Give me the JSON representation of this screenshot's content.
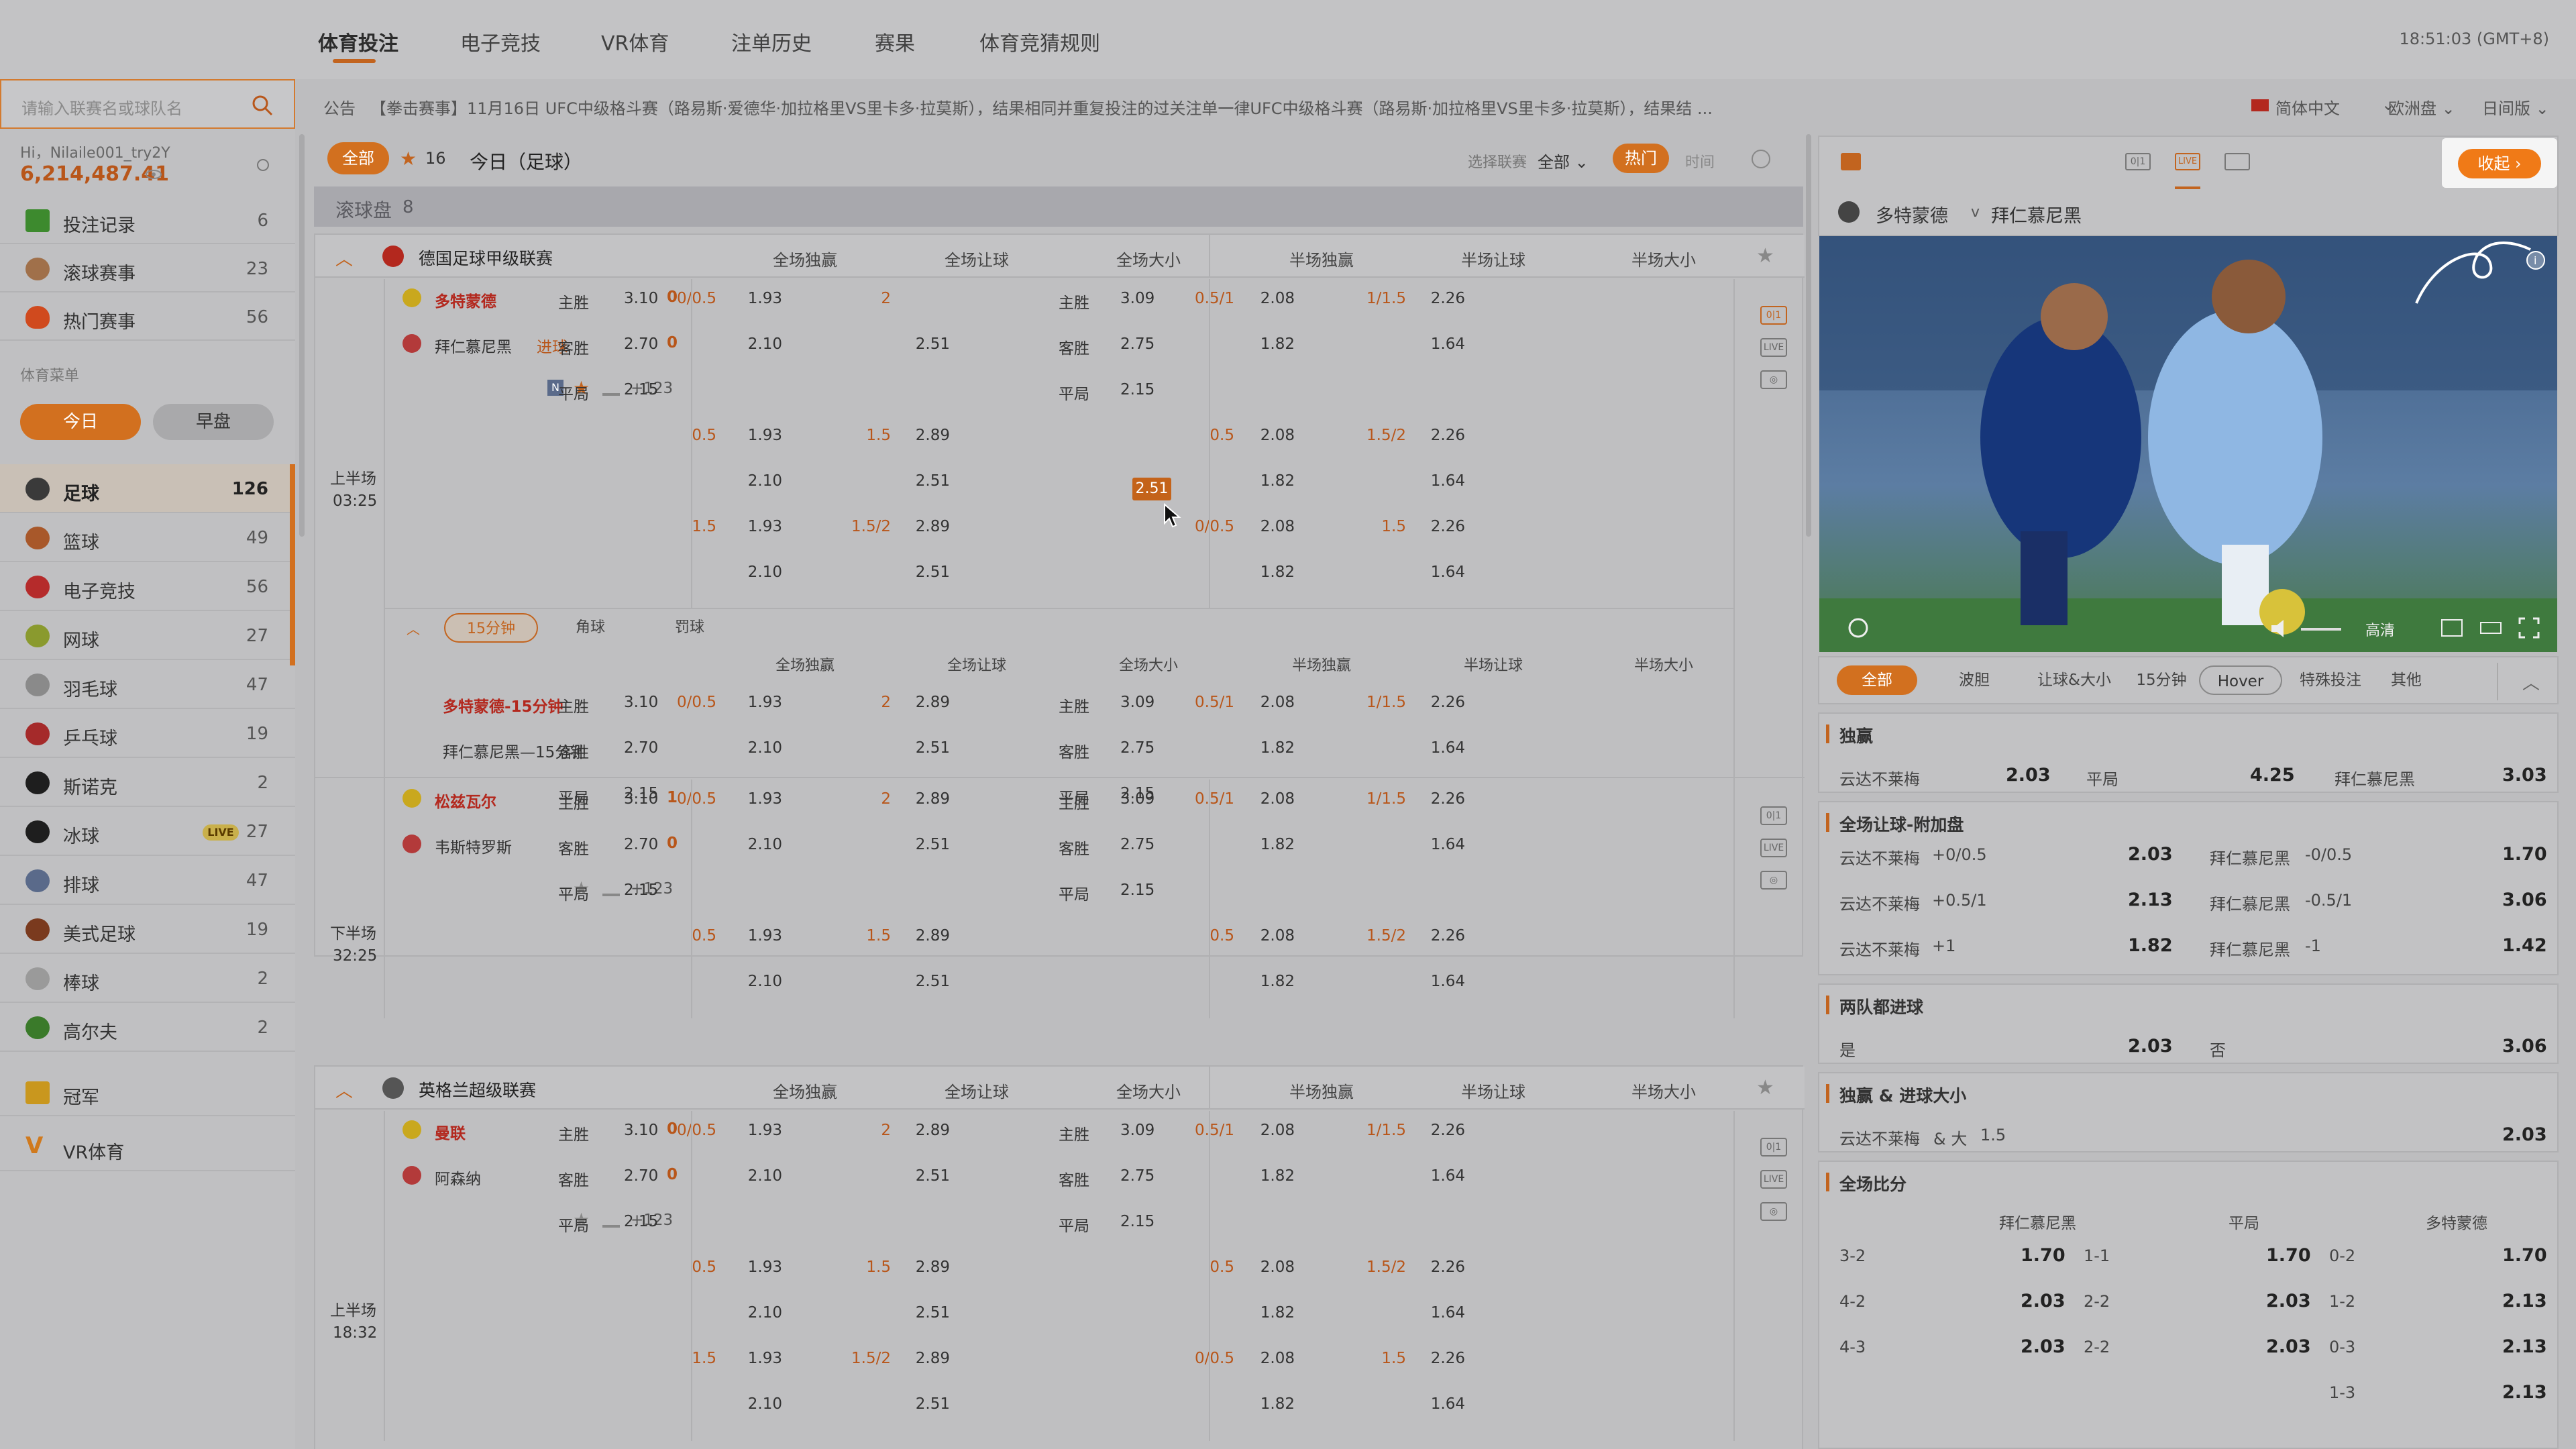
{
  "nav": {
    "items": [
      "体育投注",
      "电子竞技",
      "VR体育",
      "注单历史",
      "赛果",
      "体育竞猜规则"
    ],
    "clock": "18:51:03 (GMT+8)"
  },
  "search": {
    "placeholder": "请输入联赛名或球队名"
  },
  "notice": {
    "label": "公告",
    "text": "【拳击赛事】11月16日 UFC中级格斗赛（路易斯·爱德华·加拉格里VS里卡多·拉莫斯），结果相同并重复投注的过关注单一律UFC中级格斗赛（路易斯·加拉格里VS里卡多·拉莫斯），结果结 ...",
    "language": "简体中文",
    "odds_type": "欧洲盘",
    "view": "日间版"
  },
  "user": {
    "hi": "Hi，Nilaile001_try2Y",
    "balance": "6,214,487.41"
  },
  "sidebar": {
    "top_items": [
      {
        "label": "投注记录",
        "count": "6"
      },
      {
        "label": "滚球赛事",
        "count": "23"
      },
      {
        "label": "热门赛事",
        "count": "56"
      }
    ],
    "menu_title": "体育菜单",
    "today": "今日",
    "early": "早盘",
    "sports": [
      {
        "label": "足球",
        "count": "126",
        "color": "#3a3a3a"
      },
      {
        "label": "篮球",
        "count": "49",
        "color": "#a8582a"
      },
      {
        "label": "电子竞技",
        "count": "56",
        "color": "#b52b2b"
      },
      {
        "label": "网球",
        "count": "27",
        "color": "#8a9a2e"
      },
      {
        "label": "羽毛球",
        "count": "47",
        "color": "#8a8a8a"
      },
      {
        "label": "乒乓球",
        "count": "19",
        "color": "#a52a2a"
      },
      {
        "label": "斯诺克",
        "count": "2",
        "color": "#1e1e1e"
      },
      {
        "label": "冰球",
        "count": "27",
        "color": "#1e1e1e"
      },
      {
        "label": "排球",
        "count": "47",
        "color": "#5a6a8a"
      },
      {
        "label": "美式足球",
        "count": "19",
        "color": "#7a3a1e"
      },
      {
        "label": "棒球",
        "count": "2",
        "color": "#9a9a9a"
      },
      {
        "label": "高尔夫",
        "count": "2",
        "color": "#3a7a2a"
      }
    ],
    "live_badge": "LIVE",
    "champion": "冠军",
    "vr": "VR体育"
  },
  "main": {
    "filter_all": "全部",
    "fav_count": "16",
    "today_label": "今日（足球）",
    "select_league": "选择联赛",
    "select_value": "全部",
    "hot": "热门",
    "time": "时间",
    "inplay_label": "滚球盘",
    "inplay_count": "8",
    "col_headers": [
      "全场独赢",
      "全场让球",
      "全场大小",
      "半场独赢",
      "半场让球",
      "半场大小"
    ],
    "leagues": [
      "德国足球甲级联赛",
      "英格兰超级联赛"
    ],
    "more_markets": "+123",
    "sub_tabs": [
      "15分钟",
      "角球",
      "罚球"
    ]
  },
  "match1": {
    "home": "多特蒙德",
    "away": "拜仁慕尼黑",
    "goal_note": "进球",
    "home_score": "0",
    "away_score": "0",
    "period": "上半场",
    "time": "03:25",
    "rows": [
      [
        "主胜",
        "3.10",
        "0/0.5",
        "1.93",
        "2",
        "",
        "主胜",
        "3.09",
        "0.5/1",
        "2.08",
        "1/1.5",
        "2.26"
      ],
      [
        "客胜",
        "2.70",
        "",
        "2.10",
        "",
        "2.51",
        "客胜",
        "2.75",
        "",
        "1.82",
        "",
        "1.64"
      ],
      [
        "平局",
        "2.15",
        "",
        "",
        "",
        "",
        "平局",
        "2.15",
        "",
        "",
        "",
        ""
      ],
      [
        "",
        "",
        "0.5",
        "1.93",
        "1.5",
        "2.89",
        "",
        "",
        "0.5",
        "2.08",
        "1.5/2",
        "2.26"
      ],
      [
        "",
        "",
        "",
        "2.10",
        "",
        "2.51",
        "",
        "",
        "",
        "1.82",
        "",
        "1.64"
      ],
      [
        "",
        "",
        "1.5",
        "1.93",
        "1.5/2",
        "2.89",
        "",
        "",
        "0/0.5",
        "2.08",
        "1.5",
        "2.26"
      ],
      [
        "",
        "",
        "",
        "2.10",
        "",
        "2.51",
        "",
        "",
        "",
        "1.82",
        "",
        "1.64"
      ]
    ],
    "sub_home": "多特蒙德-15分钟",
    "sub_away": "拜仁慕尼黑—15分钟",
    "sub_rows": [
      [
        "主胜",
        "3.10",
        "0/0.5",
        "1.93",
        "2",
        "2.89",
        "主胜",
        "3.09",
        "0.5/1",
        "2.08",
        "1/1.5",
        "2.26"
      ],
      [
        "客胜",
        "2.70",
        "",
        "2.10",
        "",
        "2.51",
        "客胜",
        "2.75",
        "",
        "1.82",
        "",
        "1.64"
      ],
      [
        "平局",
        "2.15",
        "",
        "",
        "",
        "",
        "平局",
        "2.15",
        "",
        "",
        "",
        ""
      ]
    ]
  },
  "match2": {
    "home": "松兹瓦尔",
    "away": "韦斯特罗斯",
    "home_score": "1",
    "away_score": "0",
    "period": "下半场",
    "time": "32:25",
    "rows": [
      [
        "主胜",
        "3.10",
        "0/0.5",
        "1.93",
        "2",
        "2.89",
        "主胜",
        "3.09",
        "0.5/1",
        "2.08",
        "1/1.5",
        "2.26"
      ],
      [
        "客胜",
        "2.70",
        "",
        "2.10",
        "",
        "2.51",
        "客胜",
        "2.75",
        "",
        "1.82",
        "",
        "1.64"
      ],
      [
        "平局",
        "2.15",
        "",
        "",
        "",
        "",
        "平局",
        "2.15",
        "",
        "",
        "",
        ""
      ],
      [
        "",
        "",
        "0.5",
        "1.93",
        "1.5",
        "2.89",
        "",
        "",
        "0.5",
        "2.08",
        "1.5/2",
        "2.26"
      ],
      [
        "",
        "",
        "",
        "2.10",
        "",
        "2.51",
        "",
        "",
        "",
        "1.82",
        "",
        "1.64"
      ]
    ]
  },
  "match3": {
    "home": "曼联",
    "away": "阿森纳",
    "home_score": "0",
    "away_score": "0",
    "period": "上半场",
    "time": "18:32",
    "rows": [
      [
        "主胜",
        "3.10",
        "0/0.5",
        "1.93",
        "2",
        "2.89",
        "主胜",
        "3.09",
        "0.5/1",
        "2.08",
        "1/1.5",
        "2.26"
      ],
      [
        "客胜",
        "2.70",
        "",
        "2.10",
        "",
        "2.51",
        "客胜",
        "2.75",
        "",
        "1.82",
        "",
        "1.64"
      ],
      [
        "平局",
        "2.15",
        "",
        "",
        "",
        "",
        "平局",
        "2.15",
        "",
        "",
        "",
        ""
      ],
      [
        "",
        "",
        "0.5",
        "1.93",
        "1.5",
        "2.89",
        "",
        "",
        "0.5",
        "2.08",
        "1.5/2",
        "2.26"
      ],
      [
        "",
        "",
        "",
        "2.10",
        "",
        "2.51",
        "",
        "",
        "",
        "1.82",
        "",
        "1.64"
      ],
      [
        "",
        "",
        "1.5",
        "1.93",
        "1.5/2",
        "2.89",
        "",
        "",
        "0/0.5",
        "2.08",
        "1.5",
        "2.26"
      ],
      [
        "",
        "",
        "",
        "2.10",
        "",
        "2.51",
        "",
        "",
        "",
        "1.82",
        "",
        "1.64"
      ]
    ]
  },
  "right": {
    "collapse": "收起",
    "home": "多特蒙德",
    "vs": "v",
    "away": "拜仁慕尼黑",
    "video_quality": "高清",
    "tabs": [
      "全部",
      "波胆",
      "让球&大小",
      "15分钟",
      "Hover",
      "特殊投注",
      "其他"
    ],
    "win": {
      "title": "独赢",
      "items": [
        {
          "label": "云达不莱梅",
          "odd": "2.03"
        },
        {
          "label": "平局",
          "odd": "4.25"
        },
        {
          "label": "拜仁慕尼黑",
          "odd": "3.03"
        }
      ]
    },
    "handicap": {
      "title": "全场让球-附加盘",
      "rows": [
        {
          "l": "云达不莱梅",
          "lh": "+0/0.5",
          "lo": "2.03",
          "r": "拜仁慕尼黑",
          "rh": "-0/0.5",
          "ro": "1.70"
        },
        {
          "l": "云达不莱梅",
          "lh": "+0.5/1",
          "lo": "2.13",
          "r": "拜仁慕尼黑",
          "rh": "-0.5/1",
          "ro": "3.06"
        },
        {
          "l": "云达不莱梅",
          "lh": "+1",
          "lo": "1.82",
          "r": "拜仁慕尼黑",
          "rh": "-1",
          "ro": "1.42"
        }
      ]
    },
    "btts": {
      "title": "两队都进球",
      "yes": "是",
      "yes_odd": "2.03",
      "no": "否",
      "no_odd": "3.06"
    },
    "win_ou": {
      "title": "独赢 & 进球大小",
      "label": "云达不莱梅",
      "and": "& 大",
      "line": "1.5",
      "odd": "2.03"
    },
    "score": {
      "title": "全场比分",
      "cols": [
        "拜仁慕尼黑",
        "平局",
        "多特蒙德"
      ],
      "rows": [
        [
          [
            "3-2",
            "1.70"
          ],
          [
            "1-1",
            "1.70"
          ],
          [
            "0-2",
            "1.70"
          ]
        ],
        [
          [
            "4-2",
            "2.03"
          ],
          [
            "2-2",
            "2.03"
          ],
          [
            "1-2",
            "2.13"
          ]
        ],
        [
          [
            "4-3",
            "2.03"
          ],
          [
            "2-2",
            "2.03"
          ],
          [
            "0-3",
            "2.13"
          ]
        ],
        [
          [
            "",
            ""
          ],
          [
            "",
            ""
          ],
          [
            "1-3",
            "2.13"
          ]
        ]
      ]
    }
  }
}
